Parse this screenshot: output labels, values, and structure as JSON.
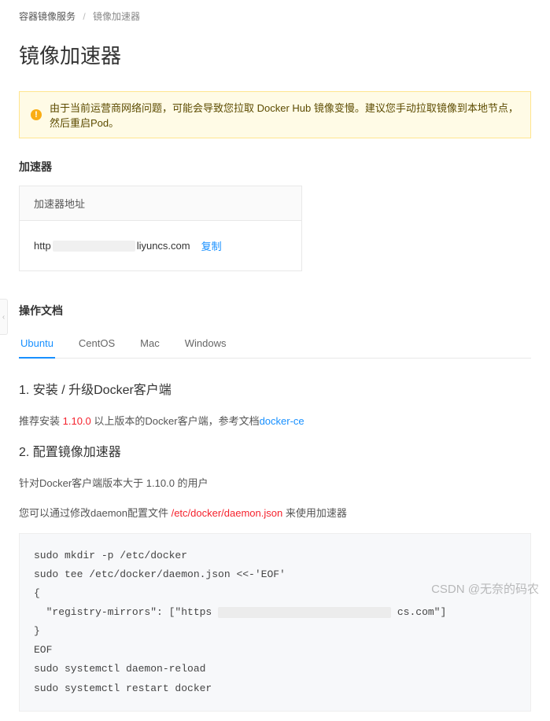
{
  "breadcrumb": {
    "parent": "容器镜像服务",
    "current": "镜像加速器"
  },
  "page_title": "镜像加速器",
  "alert": {
    "icon_glyph": "!",
    "text": "由于当前运营商网络问题，可能会导致您拉取 Docker Hub 镜像变慢。建议您手动拉取镜像到本地节点，然后重启Pod。"
  },
  "accelerator": {
    "section_label": "加速器",
    "header": "加速器地址",
    "url_prefix": "http",
    "url_suffix": "liyuncs.com",
    "copy_label": "复制"
  },
  "docs": {
    "section_label": "操作文档",
    "tabs": [
      "Ubuntu",
      "CentOS",
      "Mac",
      "Windows"
    ],
    "step1": {
      "title": "1. 安装 / 升级Docker客户端",
      "line1_pre": "推荐安装 ",
      "line1_ver": "1.10.0",
      "line1_mid": " 以上版本的Docker客户端，参考文档",
      "line1_link": "docker-ce"
    },
    "step2": {
      "title": "2. 配置镜像加速器",
      "line1": "针对Docker客户端版本大于 1.10.0 的用户",
      "line2_pre": "您可以通过修改daemon配置文件 ",
      "line2_path": "/etc/docker/daemon.json",
      "line2_post": " 来使用加速器",
      "code_l1": "sudo mkdir -p /etc/docker",
      "code_l2": "sudo tee /etc/docker/daemon.json <<-'EOF'",
      "code_l3": "{",
      "code_l4_pre": "  \"registry-mirrors\": [\"https",
      "code_l4_post": "cs.com\"]",
      "code_l5": "}",
      "code_l6": "EOF",
      "code_l7": "sudo systemctl daemon-reload",
      "code_l8": "sudo systemctl restart docker"
    }
  },
  "watermark": "CSDN @无奈的码农",
  "edge_glyph": "‹"
}
